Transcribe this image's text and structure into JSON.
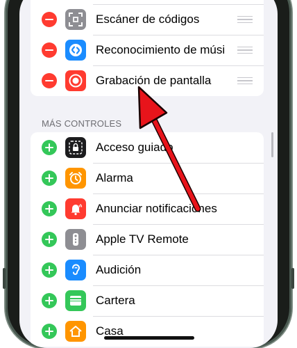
{
  "included": {
    "items": [
      {
        "label": "Escáner de códigos",
        "icon": "qr-code-icon"
      },
      {
        "label": "Reconocimiento de músi",
        "icon": "shazam-icon"
      },
      {
        "label": "Grabación de pantalla",
        "icon": "screen-record-icon"
      }
    ]
  },
  "more": {
    "title": "MÁS CONTROLES",
    "items": [
      {
        "label": "Acceso guiado",
        "icon": "guided-access-icon"
      },
      {
        "label": "Alarma",
        "icon": "alarm-icon"
      },
      {
        "label": "Anunciar notificaciones",
        "icon": "announce-notifications-icon"
      },
      {
        "label": "Apple TV Remote",
        "icon": "tv-remote-icon"
      },
      {
        "label": "Audición",
        "icon": "hearing-icon"
      },
      {
        "label": "Cartera",
        "icon": "wallet-icon"
      },
      {
        "label": "Casa",
        "icon": "home-icon"
      }
    ]
  },
  "colors": {
    "remove": "#ff3b30",
    "add": "#34c759",
    "arrow": "#e8141b"
  }
}
